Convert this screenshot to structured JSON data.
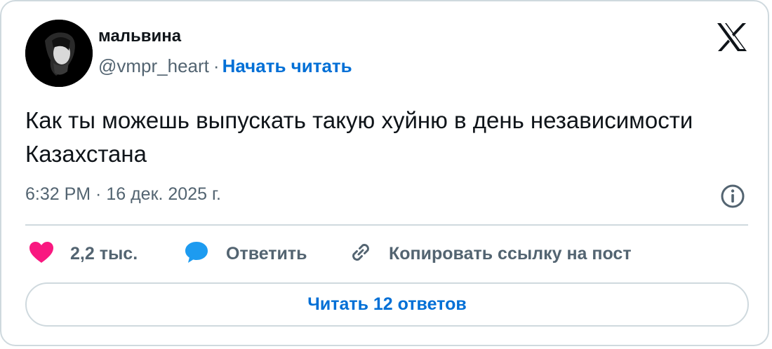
{
  "author": {
    "display_name": "мальвина",
    "handle": "@vmpr_heart",
    "separator": "·",
    "follow_label": "Начать читать"
  },
  "tweet": {
    "text": "Как ты можешь выпускать такую хуйню в день независимости Казахстана",
    "timestamp": "6:32 PM · 16 дек. 2025 г."
  },
  "actions": {
    "like_count": "2,2 тыс.",
    "reply_label": "Ответить",
    "copy_link_label": "Копировать ссылку на пост"
  },
  "read_replies_label": "Читать 12 ответов",
  "colors": {
    "link": "#006fd6",
    "like": "#f91880",
    "reply": "#1d9bf0",
    "muted": "#536471",
    "text": "#0f1419",
    "border": "#cfd9de"
  },
  "icons": [
    "x-logo-icon",
    "info-icon",
    "heart-icon",
    "speech-bubble-icon",
    "link-icon"
  ]
}
